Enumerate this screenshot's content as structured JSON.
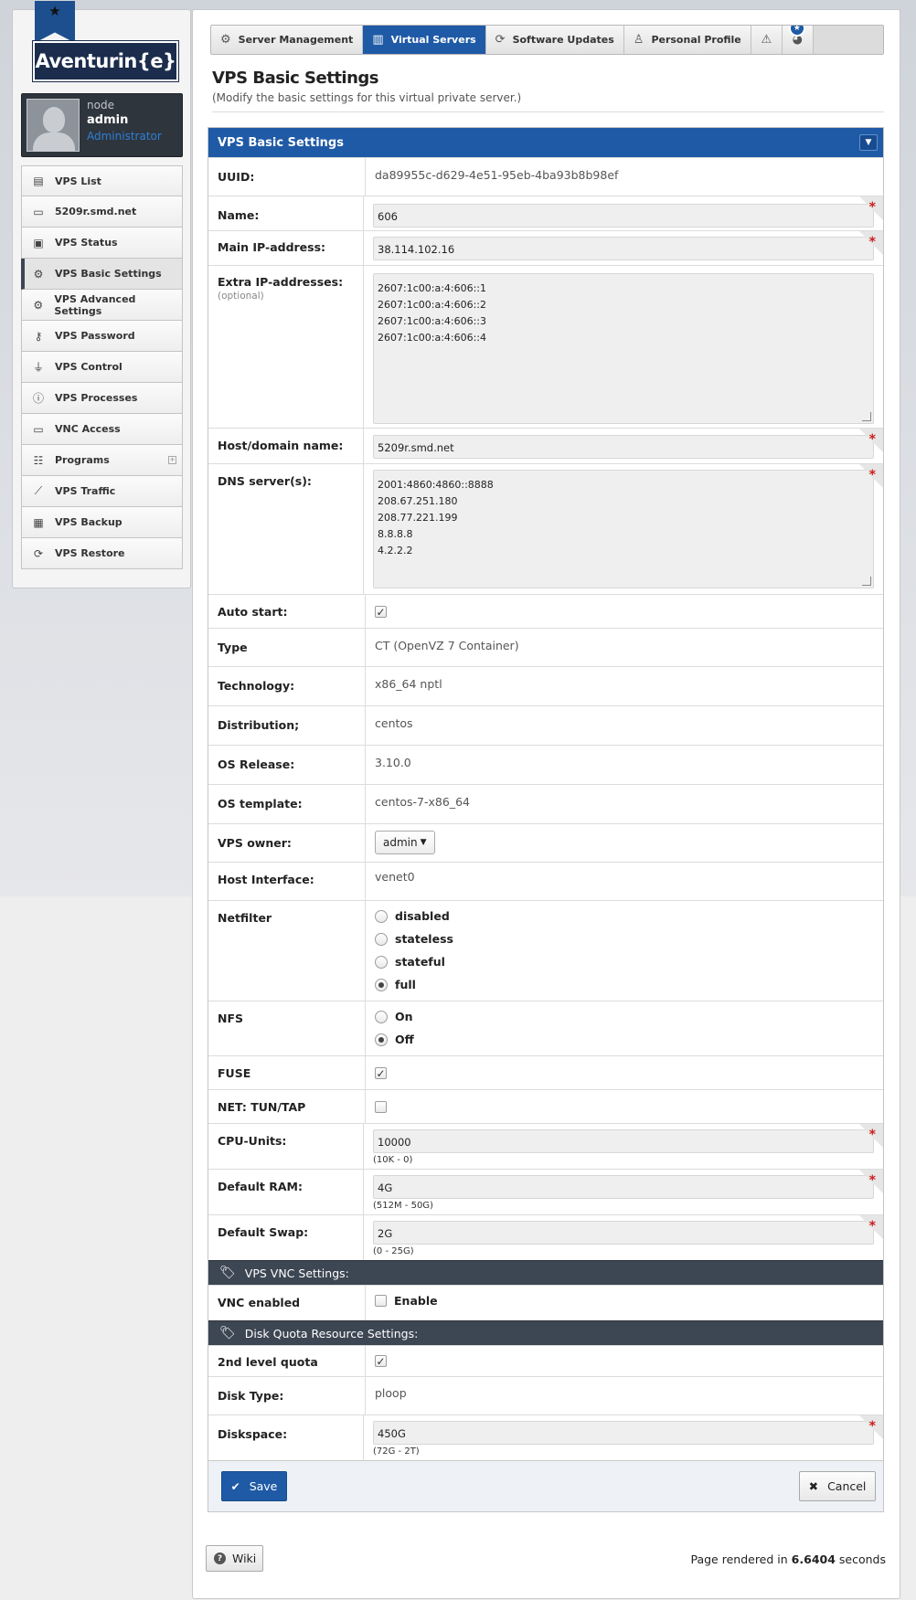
{
  "brand": {
    "logo_text": "Aventurin{e}",
    "ribbon_icon": "star-icon"
  },
  "user": {
    "node": "node",
    "name": "admin",
    "role": "Administrator"
  },
  "sidebar": {
    "items": [
      {
        "label": "VPS List",
        "icon": "list-icon"
      },
      {
        "label": "5209r.smd.net",
        "icon": "laptop-icon"
      },
      {
        "label": "VPS Status",
        "icon": "briefcase-icon"
      },
      {
        "label": "VPS Basic Settings",
        "icon": "gear-icon",
        "active": true
      },
      {
        "label": "VPS Advanced Settings",
        "icon": "gears-icon"
      },
      {
        "label": "VPS Password",
        "icon": "key-icon"
      },
      {
        "label": "VPS Control",
        "icon": "plug-icon"
      },
      {
        "label": "VPS Processes",
        "icon": "info-icon"
      },
      {
        "label": "VNC Access",
        "icon": "monitor-icon"
      },
      {
        "label": "Programs",
        "icon": "sitemap-icon",
        "expandable": true
      },
      {
        "label": "VPS Traffic",
        "icon": "chart-icon"
      },
      {
        "label": "VPS Backup",
        "icon": "archive-icon"
      },
      {
        "label": "VPS Restore",
        "icon": "refresh-icon"
      }
    ]
  },
  "tabs": [
    {
      "label": "Server Management",
      "icon": "gear-icon"
    },
    {
      "label": "Virtual Servers",
      "icon": "layout-icon",
      "active": true
    },
    {
      "label": "Software Updates",
      "icon": "refresh-icon"
    },
    {
      "label": "Personal Profile",
      "icon": "user-icon"
    }
  ],
  "page": {
    "title": "VPS Basic Settings",
    "subtitle": "(Modify the basic settings for this virtual private server.)"
  },
  "form": {
    "header": "VPS Basic Settings",
    "uuid": {
      "label": "UUID:",
      "value": "da89955c-d629-4e51-95eb-4ba93b8b98ef"
    },
    "name": {
      "label": "Name:",
      "value": "606"
    },
    "main_ip": {
      "label": "Main IP-address:",
      "value": "38.114.102.16"
    },
    "extra_ip": {
      "label": "Extra IP-addresses:",
      "hint": "(optional)",
      "lines": [
        "2607:1c00:a:4:606::1",
        "2607:1c00:a:4:606::2",
        "2607:1c00:a:4:606::3",
        "2607:1c00:a:4:606::4"
      ]
    },
    "hostname": {
      "label": "Host/domain name:",
      "value": "5209r.smd.net"
    },
    "dns": {
      "label": "DNS server(s):",
      "lines": [
        "2001:4860:4860::8888",
        "208.67.251.180",
        "208.77.221.199",
        "8.8.8.8",
        "4.2.2.2"
      ]
    },
    "autostart": {
      "label": "Auto start:",
      "checked": true
    },
    "type": {
      "label": "Type",
      "value": "CT (OpenVZ 7 Container)"
    },
    "technology": {
      "label": "Technology:",
      "value": "x86_64 nptl"
    },
    "distribution": {
      "label": "Distribution;",
      "value": "centos"
    },
    "os_release": {
      "label": "OS Release:",
      "value": "3.10.0"
    },
    "os_template": {
      "label": "OS template:",
      "value": "centos-7-x86_64"
    },
    "owner": {
      "label": "VPS owner:",
      "value": "admin"
    },
    "host_interface": {
      "label": "Host Interface:",
      "value": "venet0"
    },
    "netfilter": {
      "label": "Netfilter",
      "options": [
        "disabled",
        "stateless",
        "stateful",
        "full"
      ],
      "selected": "full"
    },
    "nfs": {
      "label": "NFS",
      "options": [
        "On",
        "Off"
      ],
      "selected": "Off"
    },
    "fuse": {
      "label": "FUSE",
      "checked": true
    },
    "tuntap": {
      "label": "NET: TUN/TAP",
      "checked": false
    },
    "cpu_units": {
      "label": "CPU-Units:",
      "value": "10000",
      "hint": "(10K - 0)"
    },
    "ram": {
      "label": "Default RAM:",
      "value": "4G",
      "hint": "(512M - 50G)"
    },
    "swap": {
      "label": "Default Swap:",
      "value": "2G",
      "hint": "(0 - 25G)"
    },
    "vnc_section": "VPS VNC Settings:",
    "vnc_enabled": {
      "label": "VNC enabled",
      "option": "Enable",
      "checked": false
    },
    "quota_section": "Disk Quota Resource Settings:",
    "second_level_quota": {
      "label": "2nd level quota",
      "checked": true
    },
    "disk_type": {
      "label": "Disk Type:",
      "value": "ploop"
    },
    "diskspace": {
      "label": "Diskspace:",
      "value": "450G",
      "hint": "(72G - 2T)"
    },
    "save_label": "Save",
    "cancel_label": "Cancel"
  },
  "footer": {
    "wiki_label": "Wiki",
    "rendered_prefix": "Page rendered in",
    "rendered_time": "6.6404",
    "rendered_suffix": "seconds"
  },
  "colors": {
    "primary": "#1f5aa6",
    "dark_section": "#3d4653",
    "required": "#cf1b1b"
  }
}
